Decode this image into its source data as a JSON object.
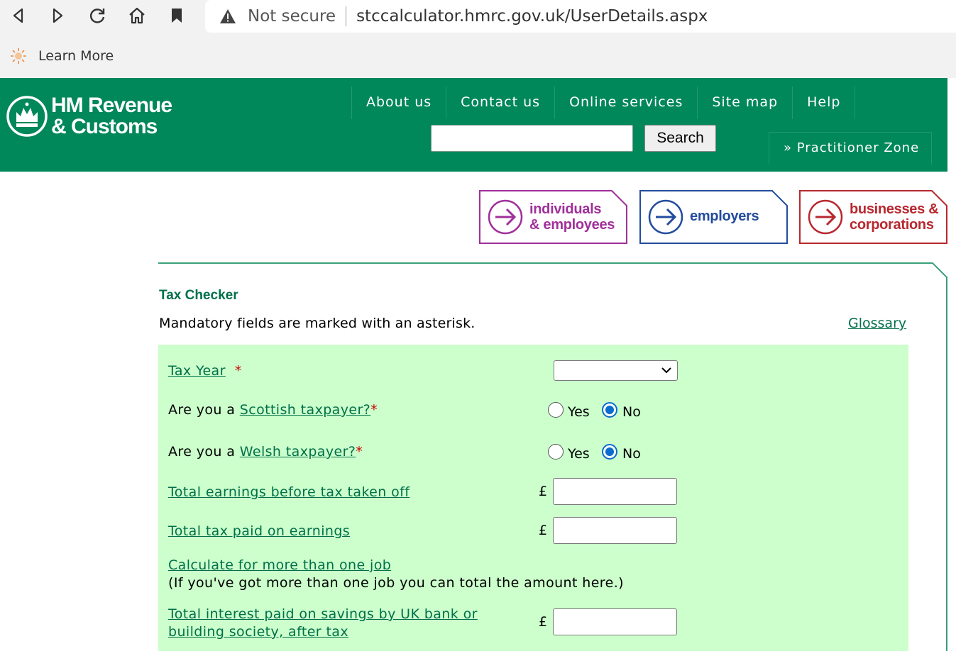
{
  "browser": {
    "not_secure": "Not secure",
    "url": "stccalculator.hmrc.gov.uk/UserDetails.aspx",
    "bookmark_label": "Learn More"
  },
  "header": {
    "logo_line1": "HM Revenue",
    "logo_line2": "& Customs",
    "nav": [
      "About us",
      "Contact us",
      "Online services",
      "Site map",
      "Help"
    ],
    "search_button": "Search",
    "practitioner": "» Practitioner Zone",
    "brand_color": "#00875a"
  },
  "audiences": [
    {
      "line1": "individuals",
      "line2": "& employees",
      "color": "#a0309a"
    },
    {
      "line1": "employers",
      "line2": "",
      "color": "#234c9c"
    },
    {
      "line1": "businesses &",
      "line2": "corporations",
      "color": "#b8282f"
    }
  ],
  "content": {
    "heading": "Tax Checker",
    "mandatory": "Mandatory fields are marked with an asterisk.",
    "glossary": "Glossary"
  },
  "form": {
    "tax_year_label": "Tax Year",
    "tax_year_value": "",
    "asterisk": "*",
    "are_you_a": "Are you a",
    "scottish_link": "Scottish taxpayer?",
    "welsh_link": "Welsh taxpayer?",
    "yes": "Yes",
    "no": "No",
    "scottish_selected": "No",
    "welsh_selected": "No",
    "pound": "£",
    "earnings_label": "Total earnings before tax taken off",
    "tax_paid_label": "Total tax paid on earnings",
    "more_jobs_link": "Calculate for more than one job",
    "more_jobs_helper": "(If you've got more than one job you can total the amount here.)",
    "interest_line1": "Total interest paid on savings by UK bank or",
    "interest_line2": "building society, after tax",
    "earnings_value": "",
    "tax_paid_value": "",
    "interest_value": ""
  }
}
